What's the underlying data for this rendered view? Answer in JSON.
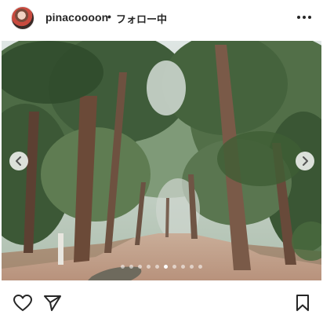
{
  "post": {
    "username": "pinacoooon",
    "separator": "•",
    "follow_status": "フォロー中"
  },
  "icons": {
    "avatar": "profile-avatar",
    "more": "more-options-icon",
    "prev": "chevron-left-icon",
    "next": "chevron-right-icon",
    "like": "heart-icon",
    "share": "paper-plane-icon",
    "save": "bookmark-icon"
  },
  "carousel": {
    "slide_count": 10,
    "active_index": 5
  },
  "colors": {
    "text": "#262626",
    "background": "#ffffff"
  }
}
